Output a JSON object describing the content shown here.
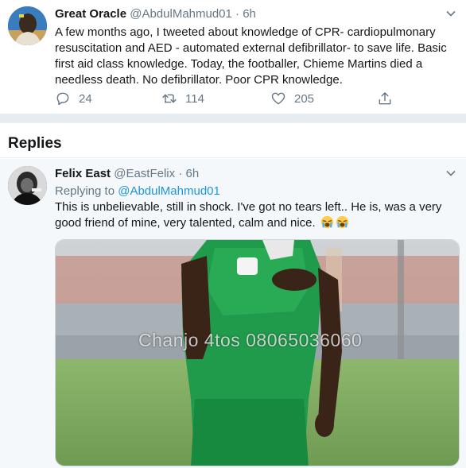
{
  "tweet": {
    "name": "Great Oracle",
    "handle": "@AbdulMahmud01",
    "dot": "·",
    "time": "6h",
    "text": "A few months ago, I tweeted about knowledge of CPR- cardiopulmonary resuscitation and AED - automated external defibrillator- to save life. Basic first aid class knowledge. Today, the footballer, Chieme Martins died a needless death. No defibrillator. Poor CPR knowledge.",
    "reply_count": "24",
    "retweet_count": "114",
    "like_count": "205"
  },
  "replies_section": {
    "title": "Replies"
  },
  "reply": {
    "name": "Felix East",
    "handle": "@EastFelix",
    "dot": "·",
    "time": "6h",
    "replying_prefix": "Replying to",
    "replying_mention": "@AbdulMahmud01",
    "text": "This is unbelievable, still in shock. I've got no tears left.. He is, was a very good friend of mine, very talented, calm and nice.",
    "media_watermark": "Chanjo 4tos 08065036060"
  },
  "colors": {
    "accent": "#1b95e0",
    "secondary_text": "#657786",
    "divider": "#e6ecf0",
    "jersey_green": "#1f9b4b"
  },
  "icons": [
    "chevron-down-icon",
    "reply-icon",
    "retweet-icon",
    "like-icon",
    "share-icon",
    "crying-face-emoji"
  ]
}
